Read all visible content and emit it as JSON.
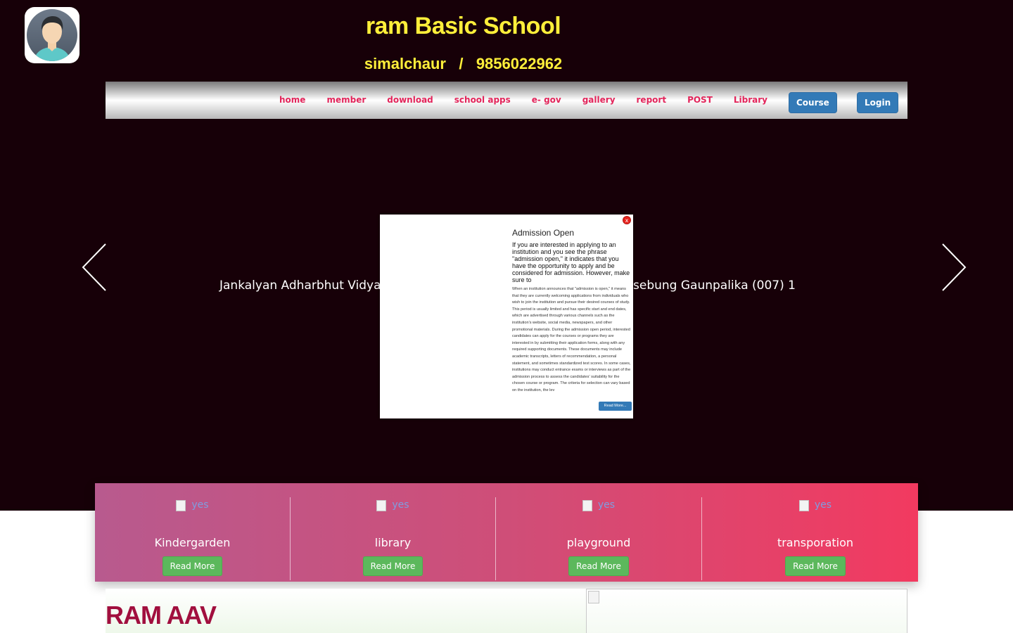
{
  "header": {
    "title": "ram Basic School",
    "location": "simalchaur",
    "separator": "/",
    "phone": "9856022962",
    "title_color": "#ffef3a",
    "avatar_icon": "user-avatar-icon"
  },
  "nav": {
    "links": [
      "home",
      "member",
      "download",
      "school apps",
      "e- gov",
      "gallery",
      "report",
      "POST",
      "Library"
    ],
    "course_button": "Course",
    "login_button": "Login",
    "link_color": "#e3245a",
    "button_color": "#337ab7"
  },
  "slider": {
    "text_left": "Jankalyan Adharbhut Vidya",
    "text_right": "sebung Gaunpalika (007) 1",
    "prev_icon": "chevron-left-icon",
    "next_icon": "chevron-right-icon"
  },
  "modal": {
    "title": "Admission Open",
    "lead": "If you are interested in applying to an institution and you see the phrase \"admission open,\" it indicates that you have the opportunity to apply and be considered for admission. However, make sure to",
    "body": "When an institution announces that \"admission is open,\" it means that they are currently welcoming applications from individuals who wish to join the institution and pursue their desired courses of study. This period is usually limited and has specific start and end dates, which are advertised through various channels such as the institution's website, social media, newspapers, and other promotional materials. During the admission open period, interested candidates can apply for the courses or programs they are interested in by submitting their application forms, along with any required supporting documents. These documents may include academic transcripts, letters of recommendation, a personal statement, and sometimes standardized test scores. In some cases, institutions may conduct entrance exams or interviews as part of the admission process to assess the candidates' suitability for the chosen course or program. The criteria for selection can vary based on the institution, the lev",
    "read_more": "Read More...",
    "close_label": "x"
  },
  "features": [
    {
      "image_alt": "yes",
      "title": "Kindergarden",
      "button": "Read More"
    },
    {
      "image_alt": "yes",
      "title": "library",
      "button": "Read More"
    },
    {
      "image_alt": "yes",
      "title": "playground",
      "button": "Read More"
    },
    {
      "image_alt": "yes",
      "title": "transporation",
      "button": "Read More"
    }
  ],
  "lower": {
    "title": "RAM AAV",
    "title_color": "#a10f3e"
  }
}
